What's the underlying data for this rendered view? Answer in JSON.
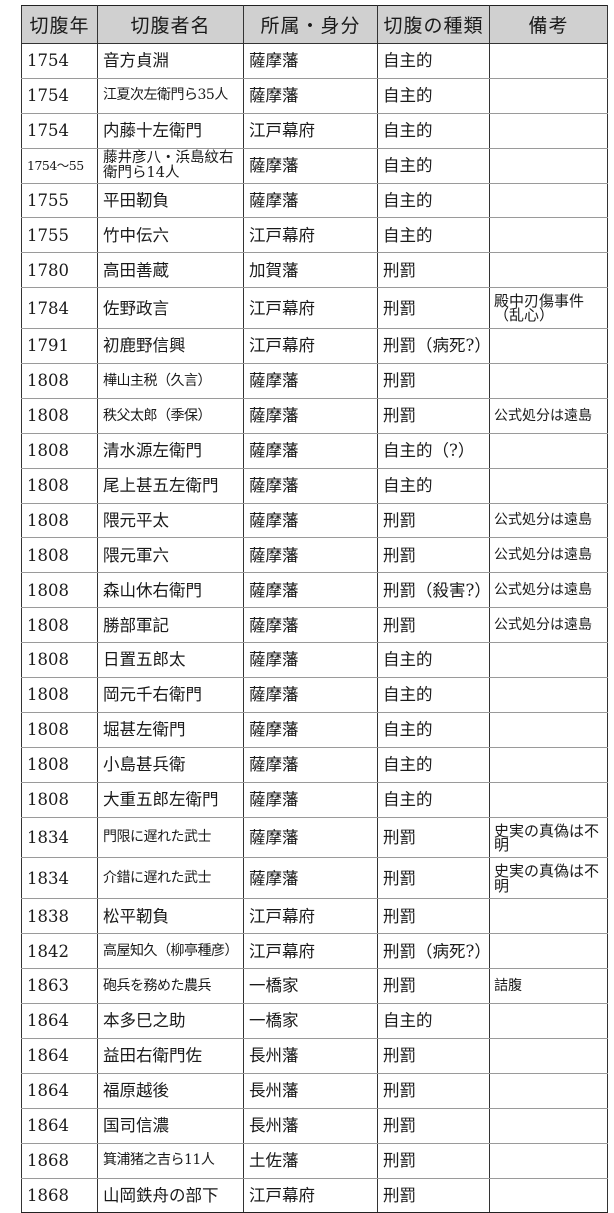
{
  "headers": [
    "切腹年",
    "切腹者名",
    "所属・身分",
    "切腹の種類",
    "備考"
  ],
  "rows": [
    {
      "year": "1754",
      "name": "音方貞淵",
      "affiliation": "薩摩藩",
      "type": "自主的",
      "note": ""
    },
    {
      "year": "1754",
      "name": "江夏次左衛門ら35人",
      "affiliation": "薩摩藩",
      "type": "自主的",
      "note": ""
    },
    {
      "year": "1754",
      "name": "内藤十左衛門",
      "affiliation": "江戸幕府",
      "type": "自主的",
      "note": ""
    },
    {
      "year": "1754〜55",
      "name": "藤井彦八・浜島紋右衛門ら14人",
      "affiliation": "薩摩藩",
      "type": "自主的",
      "note": ""
    },
    {
      "year": "1755",
      "name": "平田靭負",
      "affiliation": "薩摩藩",
      "type": "自主的",
      "note": ""
    },
    {
      "year": "1755",
      "name": "竹中伝六",
      "affiliation": "江戸幕府",
      "type": "自主的",
      "note": ""
    },
    {
      "year": "1780",
      "name": "高田善蔵",
      "affiliation": "加賀藩",
      "type": "刑罰",
      "note": ""
    },
    {
      "year": "1784",
      "name": "佐野政言",
      "affiliation": "江戸幕府",
      "type": "刑罰",
      "note": "殿中刃傷事件（乱心）"
    },
    {
      "year": "1791",
      "name": "初鹿野信興",
      "affiliation": "江戸幕府",
      "type": "刑罰（病死?）",
      "note": ""
    },
    {
      "year": "1808",
      "name": "樺山主税（久言）",
      "affiliation": "薩摩藩",
      "type": "刑罰",
      "note": ""
    },
    {
      "year": "1808",
      "name": "秩父太郎（季保）",
      "affiliation": "薩摩藩",
      "type": "刑罰",
      "note": "公式処分は遠島"
    },
    {
      "year": "1808",
      "name": "清水源左衛門",
      "affiliation": "薩摩藩",
      "type": "自主的（?）",
      "note": ""
    },
    {
      "year": "1808",
      "name": "尾上甚五左衛門",
      "affiliation": "薩摩藩",
      "type": "自主的",
      "note": ""
    },
    {
      "year": "1808",
      "name": "隈元平太",
      "affiliation": "薩摩藩",
      "type": "刑罰",
      "note": "公式処分は遠島"
    },
    {
      "year": "1808",
      "name": "隈元軍六",
      "affiliation": "薩摩藩",
      "type": "刑罰",
      "note": "公式処分は遠島"
    },
    {
      "year": "1808",
      "name": "森山休右衛門",
      "affiliation": "薩摩藩",
      "type": "刑罰（殺害?）",
      "note": "公式処分は遠島"
    },
    {
      "year": "1808",
      "name": "勝部軍記",
      "affiliation": "薩摩藩",
      "type": "刑罰",
      "note": "公式処分は遠島"
    },
    {
      "year": "1808",
      "name": "日置五郎太",
      "affiliation": "薩摩藩",
      "type": "自主的",
      "note": ""
    },
    {
      "year": "1808",
      "name": "岡元千右衛門",
      "affiliation": "薩摩藩",
      "type": "自主的",
      "note": ""
    },
    {
      "year": "1808",
      "name": "堀甚左衛門",
      "affiliation": "薩摩藩",
      "type": "自主的",
      "note": ""
    },
    {
      "year": "1808",
      "name": "小島甚兵衛",
      "affiliation": "薩摩藩",
      "type": "自主的",
      "note": ""
    },
    {
      "year": "1808",
      "name": "大重五郎左衛門",
      "affiliation": "薩摩藩",
      "type": "自主的",
      "note": ""
    },
    {
      "year": "1834",
      "name": "門限に遅れた武士",
      "affiliation": "薩摩藩",
      "type": "刑罰",
      "note": "史実の真偽は不明"
    },
    {
      "year": "1834",
      "name": "介錯に遅れた武士",
      "affiliation": "薩摩藩",
      "type": "刑罰",
      "note": "史実の真偽は不明"
    },
    {
      "year": "1838",
      "name": "松平靭負",
      "affiliation": "江戸幕府",
      "type": "刑罰",
      "note": ""
    },
    {
      "year": "1842",
      "name": "高屋知久（柳亭種彦）",
      "affiliation": "江戸幕府",
      "type": "刑罰（病死?）",
      "note": ""
    },
    {
      "year": "1863",
      "name": "砲兵を務めた農兵",
      "affiliation": "一橋家",
      "type": "刑罰",
      "note": "詰腹"
    },
    {
      "year": "1864",
      "name": "本多巳之助",
      "affiliation": "一橋家",
      "type": "自主的",
      "note": ""
    },
    {
      "year": "1864",
      "name": "益田右衛門佐",
      "affiliation": "長州藩",
      "type": "刑罰",
      "note": ""
    },
    {
      "year": "1864",
      "name": "福原越後",
      "affiliation": "長州藩",
      "type": "刑罰",
      "note": ""
    },
    {
      "year": "1864",
      "name": "国司信濃",
      "affiliation": "長州藩",
      "type": "刑罰",
      "note": ""
    },
    {
      "year": "1868",
      "name": "箕浦猪之吉ら11人",
      "affiliation": "土佐藩",
      "type": "刑罰",
      "note": ""
    },
    {
      "year": "1868",
      "name": "山岡鉄舟の部下",
      "affiliation": "江戸幕府",
      "type": "刑罰",
      "note": ""
    }
  ]
}
